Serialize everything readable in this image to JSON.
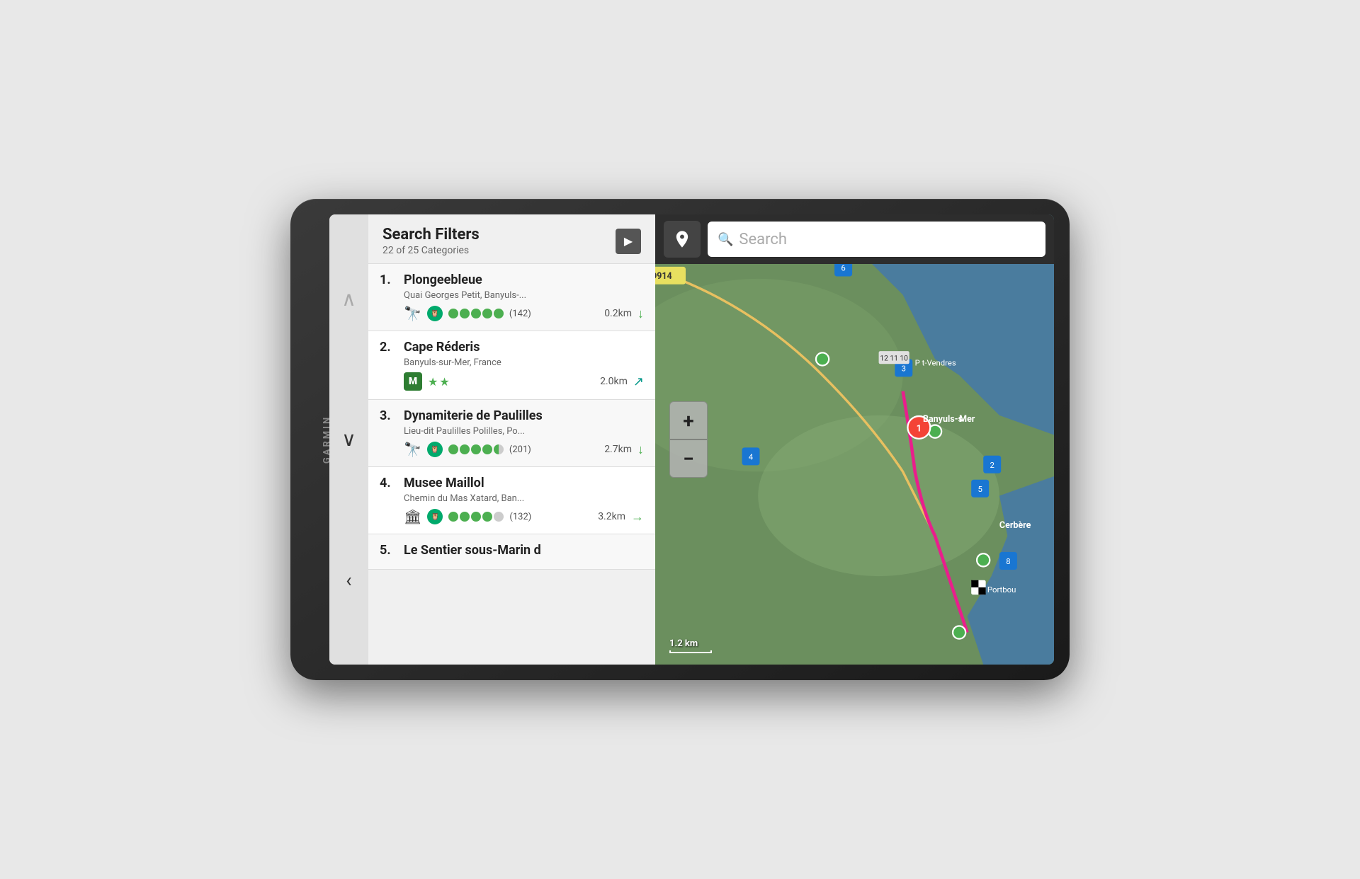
{
  "device": {
    "brand": "GARMIN"
  },
  "left_panel": {
    "header": {
      "title": "Search Filters",
      "subtitle": "22 of 25 Categories",
      "arrow_label": "▶"
    },
    "nav": {
      "up_arrow": "∧",
      "down_arrow": "∨",
      "back_arrow": "‹"
    },
    "results": [
      {
        "number": "1.",
        "name": "Plongeebleue",
        "address": "Quai Georges Petit, Banyuls-...",
        "rating_count": "(142)",
        "distance": "0.2km",
        "icon_type": "binoculars",
        "arrow": "↓",
        "arrow_color": "green"
      },
      {
        "number": "2.",
        "name": "Cape Réderis",
        "address": "Banyuls-sur-Mer, France",
        "rating_stars": 2,
        "distance": "2.0km",
        "icon_type": "michelin",
        "arrow": "↑",
        "arrow_color": "teal"
      },
      {
        "number": "3.",
        "name": "Dynamiterie de Paulilles",
        "address": "Lieu-dit Paulilles Polilles, Po...",
        "rating_count": "(201)",
        "distance": "2.7km",
        "icon_type": "binoculars",
        "arrow": "↓",
        "arrow_color": "green"
      },
      {
        "number": "4.",
        "name": "Musee Maillol",
        "address": "Chemin du Mas Xatard, Ban...",
        "rating_count": "(132)",
        "distance": "3.2km",
        "icon_type": "museum",
        "arrow": "→",
        "arrow_color": "green"
      },
      {
        "number": "5.",
        "name": "Le Sentier sous-Marin d",
        "address": "",
        "icon_type": "binoculars"
      }
    ]
  },
  "map_panel": {
    "search_placeholder": "Search",
    "zoom_in": "+",
    "zoom_out": "−",
    "scale": "1.2 km",
    "location_icon": "📍"
  }
}
